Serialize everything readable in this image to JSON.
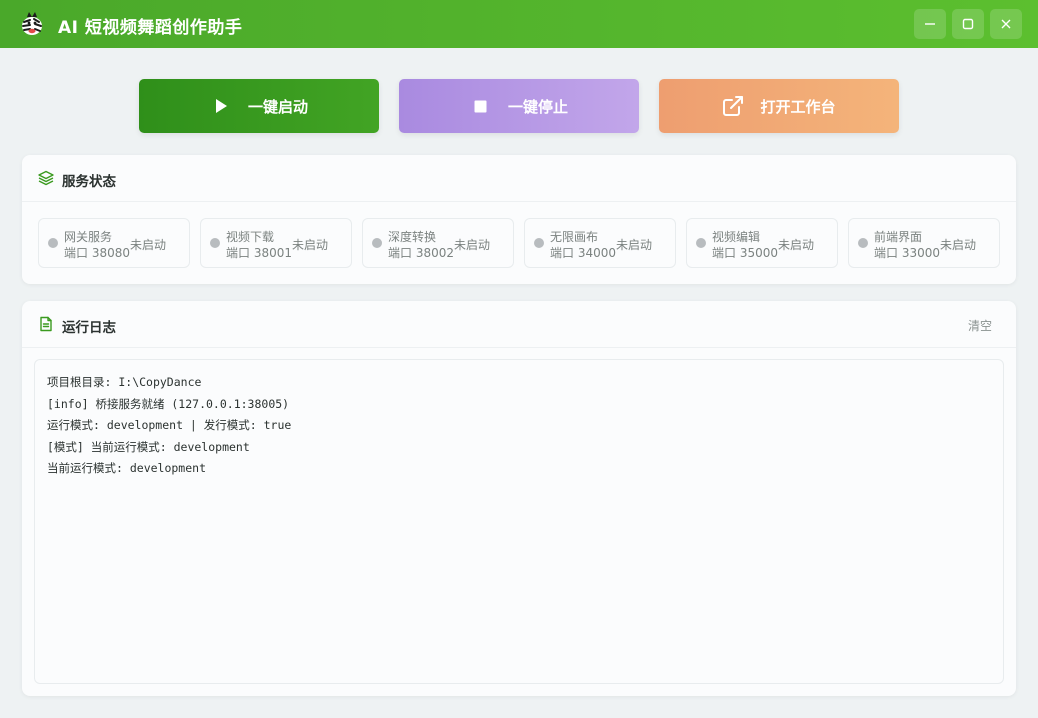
{
  "window": {
    "title": "AI 短视频舞蹈创作助手",
    "controls": {
      "minimize": "minimize-icon",
      "maximize": "maximize-icon",
      "close": "close-icon"
    },
    "accent": "#4aa82a"
  },
  "actions": {
    "start": {
      "label": "一键启动",
      "icon": "play-icon",
      "color": "#3a9a1f"
    },
    "stop": {
      "label": "一键停止",
      "icon": "stop-icon",
      "color": "#b497e5"
    },
    "open": {
      "label": "打开工作台",
      "icon": "external-link-icon",
      "color": "#f1a874"
    }
  },
  "status_panel": {
    "title": "服务状态",
    "icon": "layers-icon",
    "services": [
      {
        "name": "网关服务",
        "port": "端口 38080",
        "state": "未启动"
      },
      {
        "name": "视频下载",
        "port": "端口 38001",
        "state": "未启动"
      },
      {
        "name": "深度转换",
        "port": "端口 38002",
        "state": "未启动"
      },
      {
        "name": "无限画布",
        "port": "端口 34000",
        "state": "未启动"
      },
      {
        "name": "视频编辑",
        "port": "端口 35000",
        "state": "未启动"
      },
      {
        "name": "前端界面",
        "port": "端口 33000",
        "state": "未启动"
      }
    ],
    "state_color": "#b8bcbf"
  },
  "log_panel": {
    "title": "运行日志",
    "icon": "document-icon",
    "clear_label": "清空",
    "lines": [
      "项目根目录: I:\\CopyDance",
      "[info] 桥接服务就绪 (127.0.0.1:38005)",
      "运行模式: development | 发行模式: true",
      "[模式] 当前运行模式: development",
      "当前运行模式: development"
    ]
  }
}
